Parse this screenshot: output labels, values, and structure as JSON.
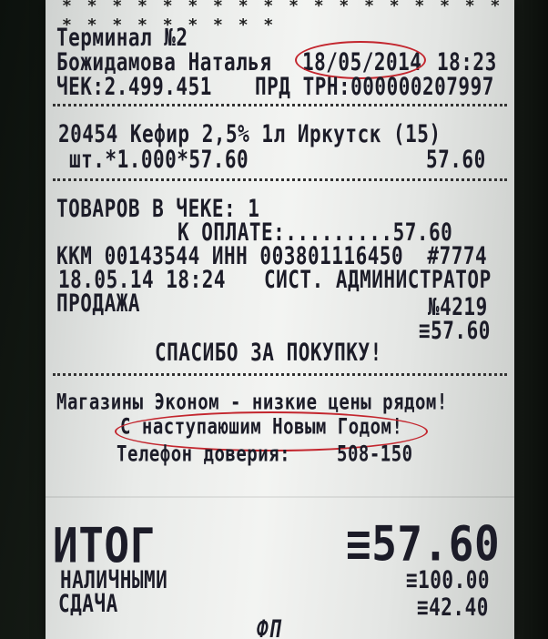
{
  "receipt": {
    "stars": "* * * * * * * * * * * * * * * * * * * * * * * * * * *",
    "terminal": "Терминал №2",
    "cashier": "Божидамова Наталья",
    "date": "18/05/2014",
    "time": "18:23",
    "check_no": "ЧЕК:2.499.451",
    "prd_trn": "ПРД ТРН:000000207997",
    "item_line1": "20454 Кефир 2,5% 1л Иркутск (15)",
    "item_line2_left": "шт.*1.000*57.60",
    "item_line2_right": "57.60",
    "items_count": "ТОВАРОВ В ЧЕКЕ: 1",
    "to_pay": "К ОПЛАТЕ:.........57.60",
    "kkm": "ККМ 00143544 ИНН 003801116450  #7774",
    "datetime2": "18.05.14 18:24",
    "admin": "СИСТ. АДМИНИСТРАТОР",
    "sale": "ПРОДАЖА",
    "doc_no": "№4219",
    "sum_small": "≡57.60",
    "thanks": "СПАСИБО ЗА ПОКУПКУ!",
    "promo1": "Магазины Эконом - низкие цены рядом!",
    "promo2": "С наступаюшим Новым Годом!",
    "phone_label": "Телефон доверия:",
    "phone": "508-150",
    "total_label": "ИТОГ",
    "total_value": "≡57.60",
    "cash_label": "НАЛИЧНЫМИ",
    "cash_value": "≡100.00",
    "change_label": "СДАЧА",
    "change_value": "≡42.40",
    "fp": "ФП"
  },
  "colors": {
    "oval": "#c3262e",
    "ink": "#1c1c28",
    "paper": "#eef0ee"
  }
}
